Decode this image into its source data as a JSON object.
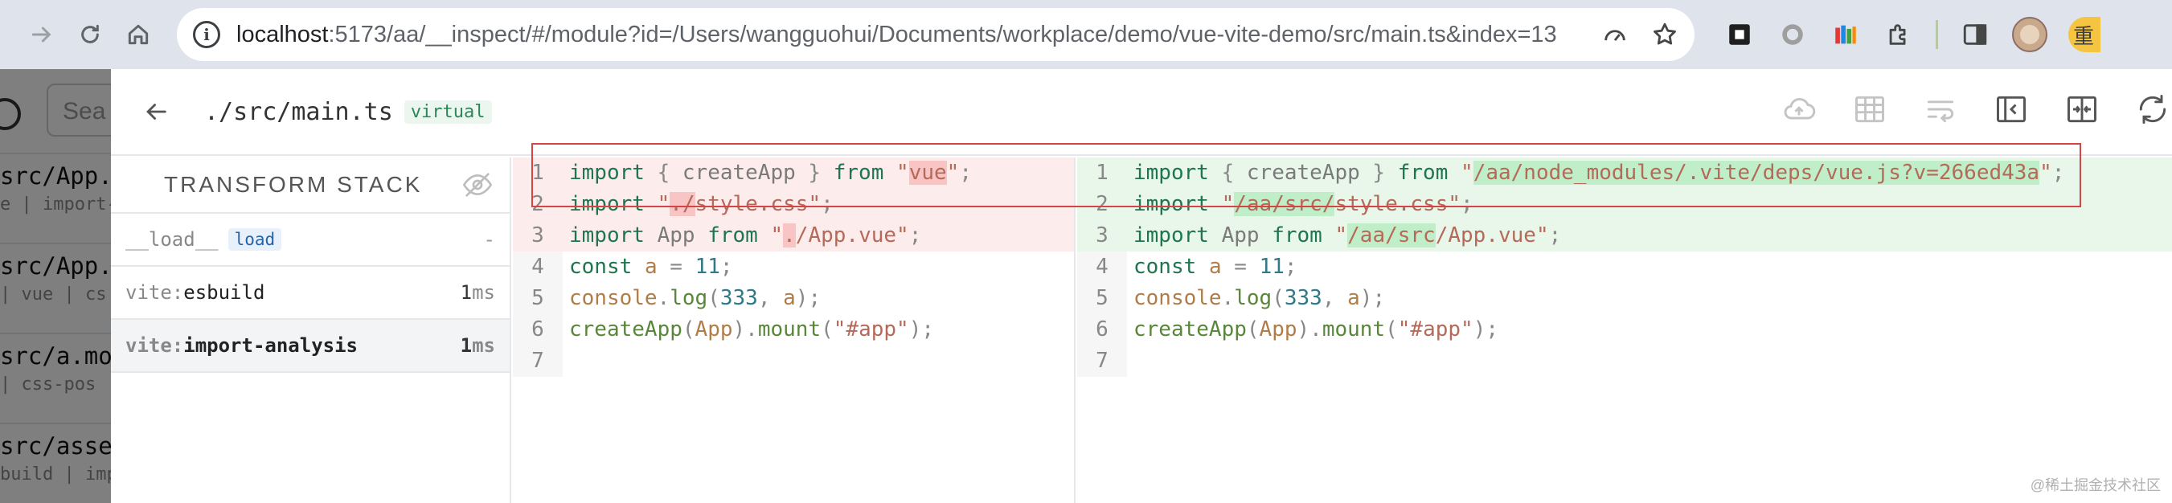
{
  "browser": {
    "url_host": "localhost",
    "url_rest": ":5173/aa/__inspect/#/module?id=/Users/wangguohui/Documents/workplace/demo/vue-vite-demo/src/main.ts&index=13",
    "profile_char": "重"
  },
  "background_app": {
    "search_placeholder": "Sea",
    "items": [
      {
        "title": "src/App.v",
        "tags": "e | import-"
      },
      {
        "title": "src/App.v",
        "tags": "| vue | cs"
      },
      {
        "title": "src/a.moc",
        "tags": "| css-pos"
      },
      {
        "title": "src/asset",
        "tags": "build | imp"
      }
    ]
  },
  "module": {
    "path": "./src/main.ts",
    "badge": "virtual"
  },
  "transform_stack": {
    "title": "TRANSFORM STACK",
    "rows": [
      {
        "prefix": "",
        "name": "__load__",
        "hook": "load",
        "time": "",
        "unit": "",
        "dash": "-"
      },
      {
        "prefix": "vite:",
        "name": "esbuild",
        "hook": "",
        "time": "1",
        "unit": "ms",
        "dash": ""
      },
      {
        "prefix": "vite:",
        "name": "import-analysis",
        "hook": "",
        "time": "1",
        "unit": "ms",
        "dash": ""
      }
    ]
  },
  "diff": {
    "left": {
      "line_numbers": [
        "1",
        "2",
        "3",
        "4",
        "5",
        "6",
        "7"
      ],
      "l1": {
        "kw": "import",
        "ob": " { ",
        "id": "createApp",
        "cb": " } ",
        "kw2": "from",
        "sp": " ",
        "q1": "\"",
        "hl": "vue",
        "q2": "\"",
        "end": ";"
      },
      "l2": {
        "kw": "import",
        "sp": " ",
        "q1": "\"",
        "hl": "./",
        "rest": "style.css",
        "q2": "\"",
        "end": ";"
      },
      "l3": {
        "kw": "import",
        "sp": " ",
        "id": "App",
        "sp2": " ",
        "kw2": "from",
        "sp3": " ",
        "q1": "\"",
        "hl": ".",
        "rest": "/App.vue",
        "q2": "\"",
        "end": ";"
      },
      "l4": {
        "kw": "const",
        "sp": " ",
        "var": "a",
        "eq": " = ",
        "num": "11",
        "end": ";"
      },
      "l5": {
        "obj": "console",
        "dot": ".",
        "fn": "log",
        "po": "(",
        "num": "333",
        "comma": ", ",
        "var": "a",
        "pc": ");"
      },
      "l6": {
        "fn": "createApp",
        "po": "(",
        "arg": "App",
        "pc": ").",
        "fn2": "mount",
        "po2": "(",
        "str": "\"#app\"",
        "pc2": ");"
      }
    },
    "right": {
      "line_numbers": [
        "1",
        "2",
        "3",
        "4",
        "5",
        "6",
        "7"
      ],
      "l1": {
        "kw": "import",
        "ob": " { ",
        "id": "createApp",
        "cb": " } ",
        "kw2": "from",
        "sp": " ",
        "q1": "\"",
        "hl": "/aa/node_modules/.vite/deps/vue.js?v=266ed43a",
        "q2": "\"",
        "end": ";"
      },
      "l2": {
        "kw": "import",
        "sp": " ",
        "q1": "\"",
        "hl": "/aa/src/",
        "rest": "style.css",
        "q2": "\"",
        "end": ";"
      },
      "l3": {
        "kw": "import",
        "sp": " ",
        "id": "App",
        "sp2": " ",
        "kw2": "from",
        "sp3": " ",
        "q1": "\"",
        "hl": "/aa/src",
        "rest": "/App.vue",
        "q2": "\"",
        "end": ";"
      },
      "l4": {
        "kw": "const",
        "sp": " ",
        "var": "a",
        "eq": " = ",
        "num": "11",
        "end": ";"
      },
      "l5": {
        "obj": "console",
        "dot": ".",
        "fn": "log",
        "po": "(",
        "num": "333",
        "comma": ", ",
        "var": "a",
        "pc": ");"
      },
      "l6": {
        "fn": "createApp",
        "po": "(",
        "arg": "App",
        "pc": ").",
        "fn2": "mount",
        "po2": "(",
        "str": "\"#app\"",
        "pc2": ");"
      }
    }
  },
  "watermark": "@稀土掘金技术社区",
  "colors": {
    "removed_bg": "#fdecec",
    "added_bg": "#e8f7ea",
    "annotation_box": "#d64545"
  }
}
